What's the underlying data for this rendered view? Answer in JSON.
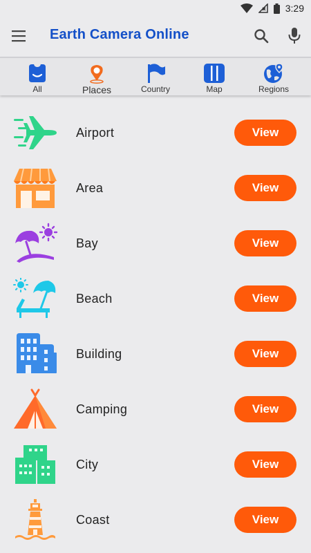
{
  "status_bar": {
    "time": "3:29",
    "icons": [
      "wifi-icon",
      "no-signal-icon",
      "battery-icon"
    ]
  },
  "app_bar": {
    "title": "Earth Camera Online",
    "title_color": "#1450c8",
    "icons": [
      "menu-icon",
      "search-icon",
      "mic-icon"
    ]
  },
  "tabs": [
    {
      "label": "All",
      "icon": "home-icon",
      "color": "#1d5fd6"
    },
    {
      "label": "Places",
      "icon": "place-pin-icon",
      "color": "#f26b1d"
    },
    {
      "label": "Country",
      "icon": "flag-icon",
      "color": "#1d5fd6"
    },
    {
      "label": "Map",
      "icon": "map-icon",
      "color": "#1d5fd6"
    },
    {
      "label": "Regions",
      "icon": "globe-icon",
      "color": "#1d5fd6"
    }
  ],
  "list": {
    "button_label": "View",
    "button_color": "#ff5a0a",
    "items": [
      {
        "label": "Airport",
        "icon": "airplane-icon",
        "color": "#2fd48a"
      },
      {
        "label": "Area",
        "icon": "storefront-icon",
        "color": "#ff9a3c"
      },
      {
        "label": "Bay",
        "icon": "beach-umbrella-icon",
        "color": "#9b3fe0"
      },
      {
        "label": "Beach",
        "icon": "sun-lounger-icon",
        "color": "#1ec8e8"
      },
      {
        "label": "Building",
        "icon": "buildings-icon",
        "color": "#3a8be8"
      },
      {
        "label": "Camping",
        "icon": "tent-icon",
        "color": "#ff6a2a"
      },
      {
        "label": "City",
        "icon": "city-icon",
        "color": "#2fd48a"
      },
      {
        "label": "Coast",
        "icon": "lighthouse-icon",
        "color": "#ff9a3c"
      }
    ]
  }
}
